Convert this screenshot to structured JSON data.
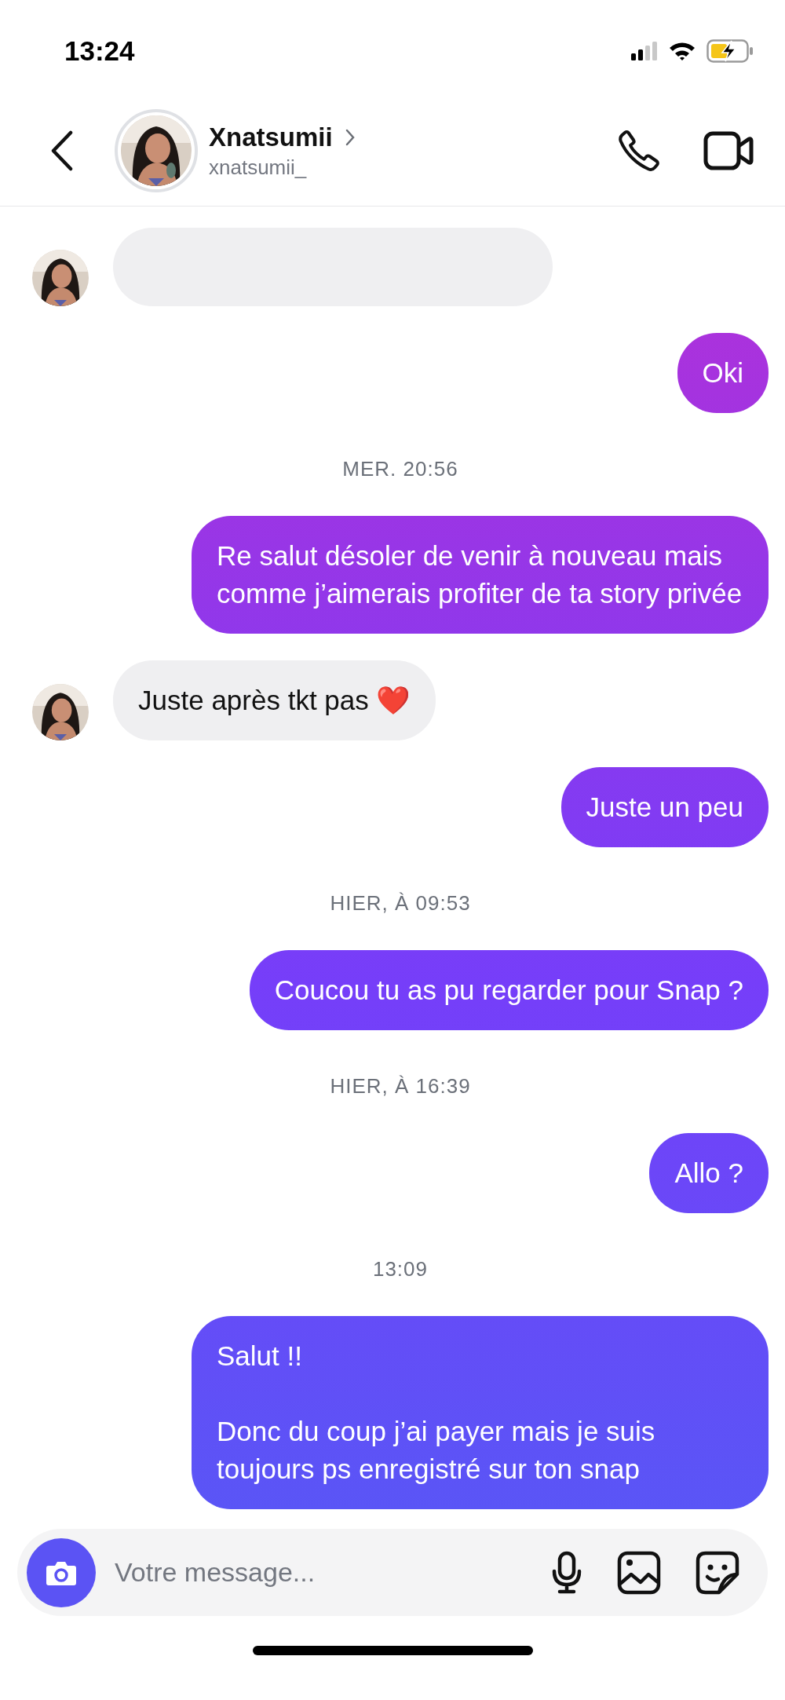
{
  "status_bar": {
    "time": "13:24"
  },
  "header": {
    "name": "Xnatsumii",
    "username": "xnatsumii_"
  },
  "messages": [
    {
      "kind": "received_cut"
    },
    {
      "kind": "sent",
      "text": "Oki"
    },
    {
      "kind": "timestamp",
      "text": "MER. 20:56"
    },
    {
      "kind": "sent",
      "text": "Re salut désoler de venir à nouveau mais comme j’aimerais profiter de ta story privée"
    },
    {
      "kind": "received",
      "text": "Juste après tkt pas ❤️"
    },
    {
      "kind": "sent",
      "text": "Juste un peu"
    },
    {
      "kind": "timestamp",
      "text": "HIER, À 09:53"
    },
    {
      "kind": "sent",
      "text": "Coucou tu as pu regarder pour Snap ?"
    },
    {
      "kind": "timestamp",
      "text": "HIER, À 16:39"
    },
    {
      "kind": "sent",
      "text": "Allo ?"
    },
    {
      "kind": "timestamp",
      "text": "13:09"
    },
    {
      "kind": "sent",
      "text": "Salut !!\n\nDonc du coup j’ai payer mais je suis toujours ps enregistré sur ton snap"
    }
  ],
  "composer": {
    "placeholder": "Votre message..."
  }
}
